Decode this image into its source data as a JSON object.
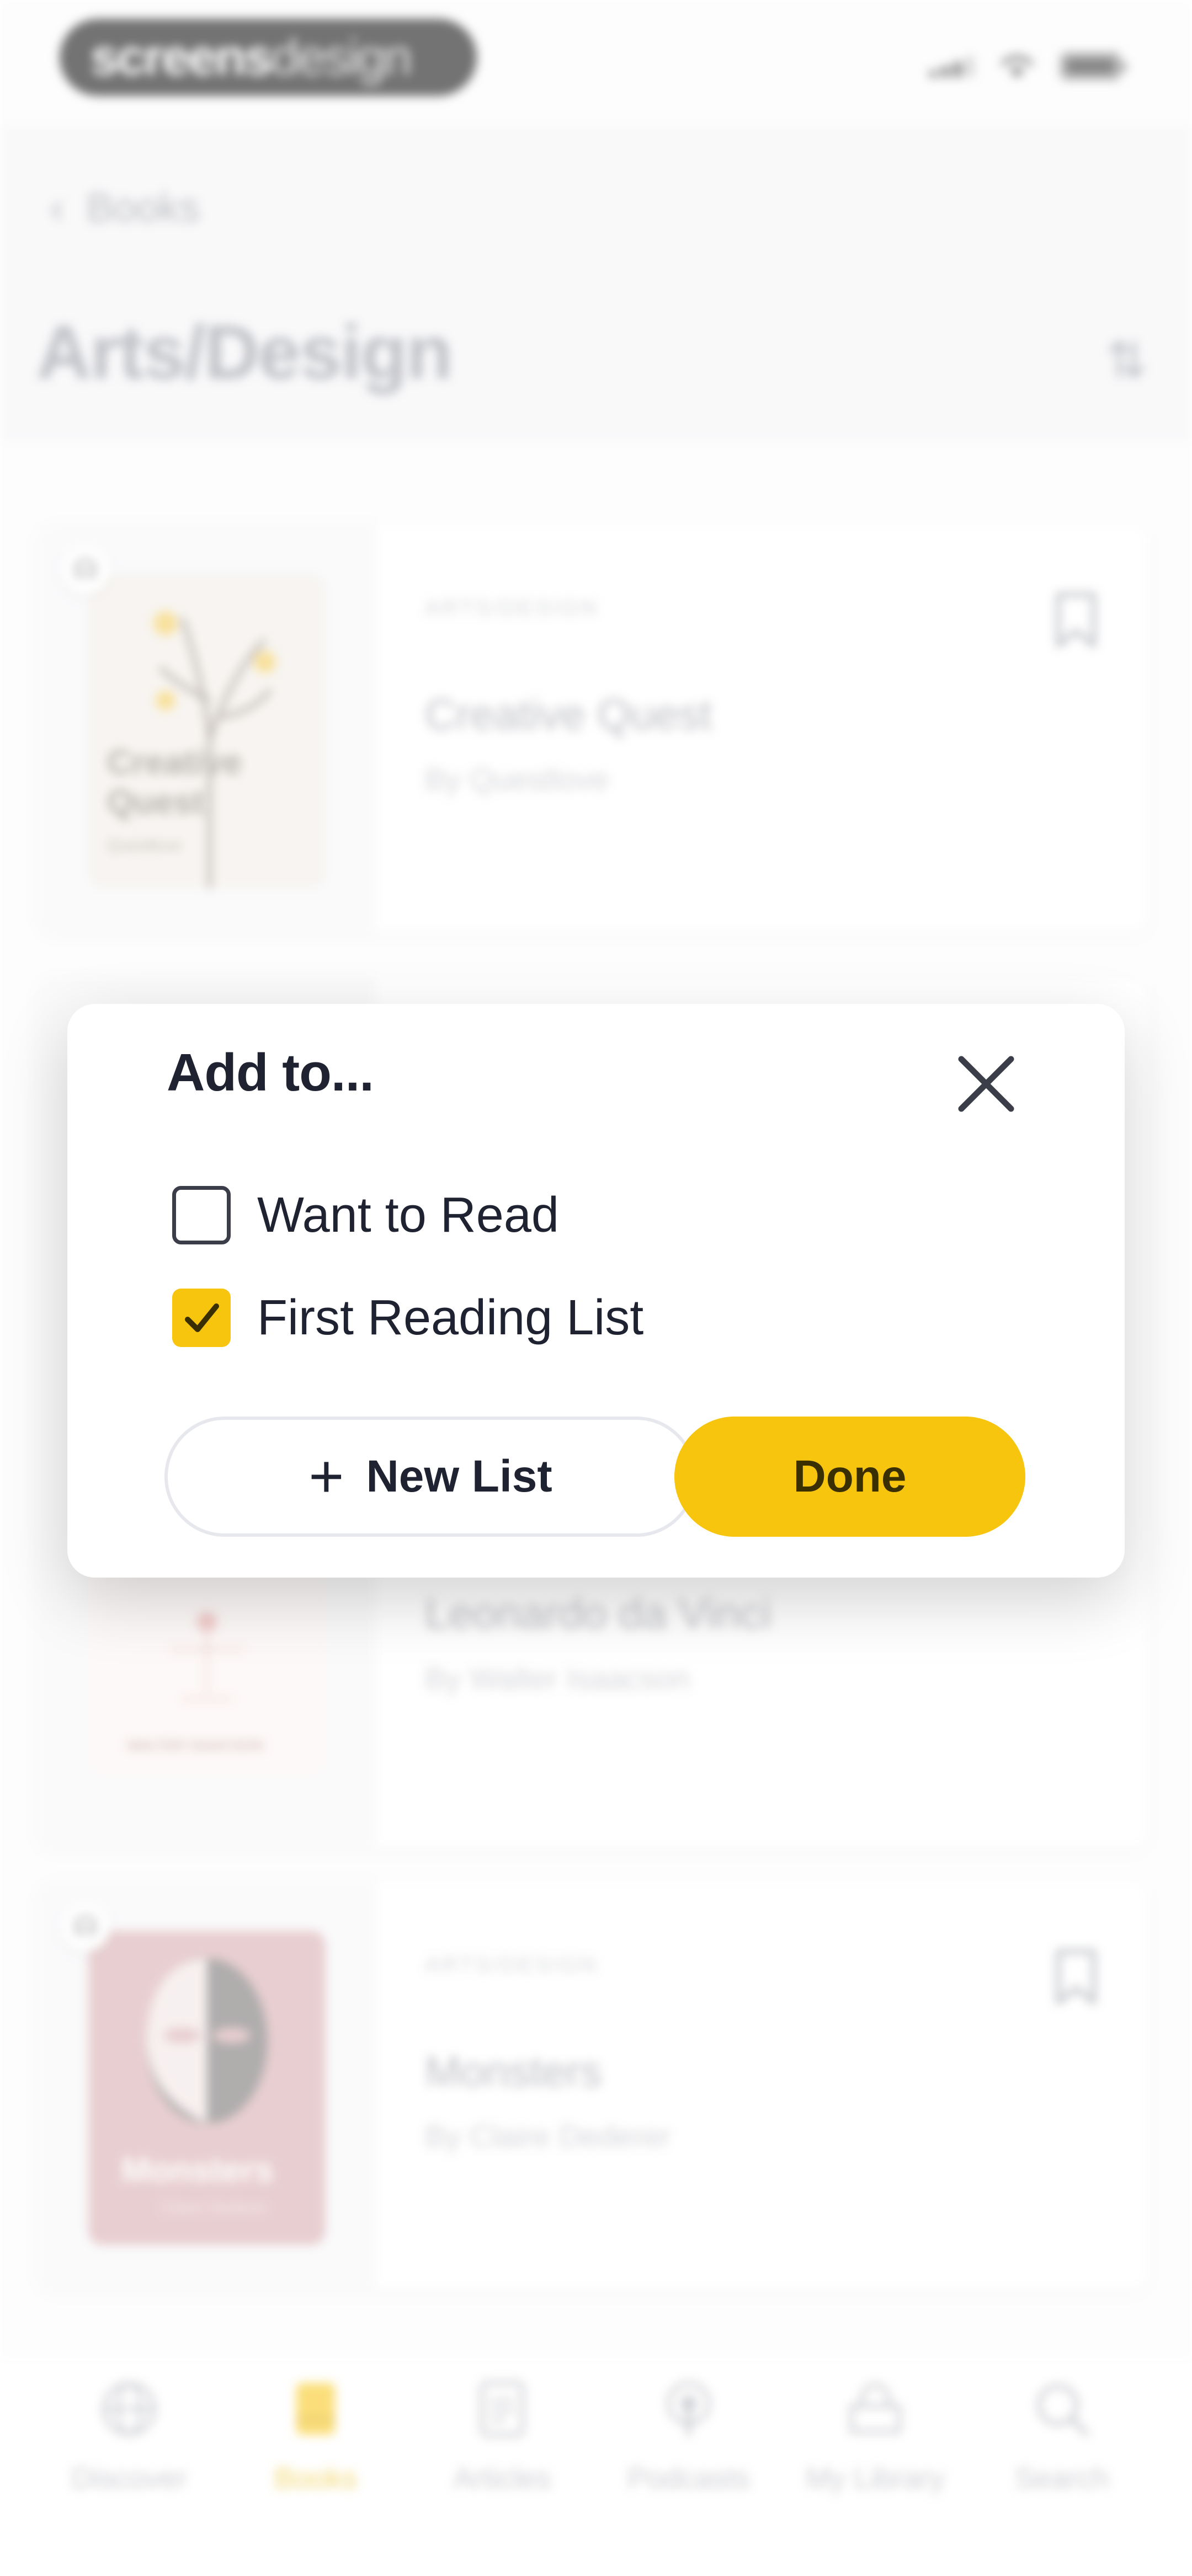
{
  "status_bar": {
    "logo_bold": "screens",
    "logo_light": "design"
  },
  "header": {
    "back_label": "Books",
    "title": "Arts/Design"
  },
  "books": [
    {
      "category": "ARTS/DESIGN",
      "title": "Creative Quest",
      "author": "By Questlove",
      "cover_title": "Creative Quest",
      "cover_author": "Questlove",
      "cover_color": "#f1ece6"
    },
    {
      "category": "",
      "title": "Leonardo da Vinci",
      "author": "By Walter Isaacson",
      "cover_title": "",
      "cover_author": "WALTER ISAACSON",
      "cover_color": "#fbf4f2"
    },
    {
      "category": "ARTS/DESIGN",
      "title": "Monsters",
      "author": "By Claire Dederer",
      "cover_title": "Monsters",
      "cover_author": "Claire Dederer",
      "cover_color": "#d6a7ab"
    }
  ],
  "modal": {
    "title": "Add to...",
    "options": [
      {
        "label": "Want to Read",
        "checked": false
      },
      {
        "label": "First Reading List",
        "checked": true
      }
    ],
    "new_list_label": "New List",
    "done_label": "Done"
  },
  "tabbar": [
    {
      "label": "Discover",
      "icon": "globe-icon",
      "active": false
    },
    {
      "label": "Books",
      "icon": "book-icon",
      "active": true
    },
    {
      "label": "Articles",
      "icon": "article-icon",
      "active": false
    },
    {
      "label": "Podcasts",
      "icon": "podcast-icon",
      "active": false
    },
    {
      "label": "My Library",
      "icon": "library-icon",
      "active": false
    },
    {
      "label": "Search",
      "icon": "search-icon",
      "active": false
    }
  ],
  "colors": {
    "accent": "#f7c40e",
    "text": "#1f2230",
    "muted": "#8c8f99"
  }
}
